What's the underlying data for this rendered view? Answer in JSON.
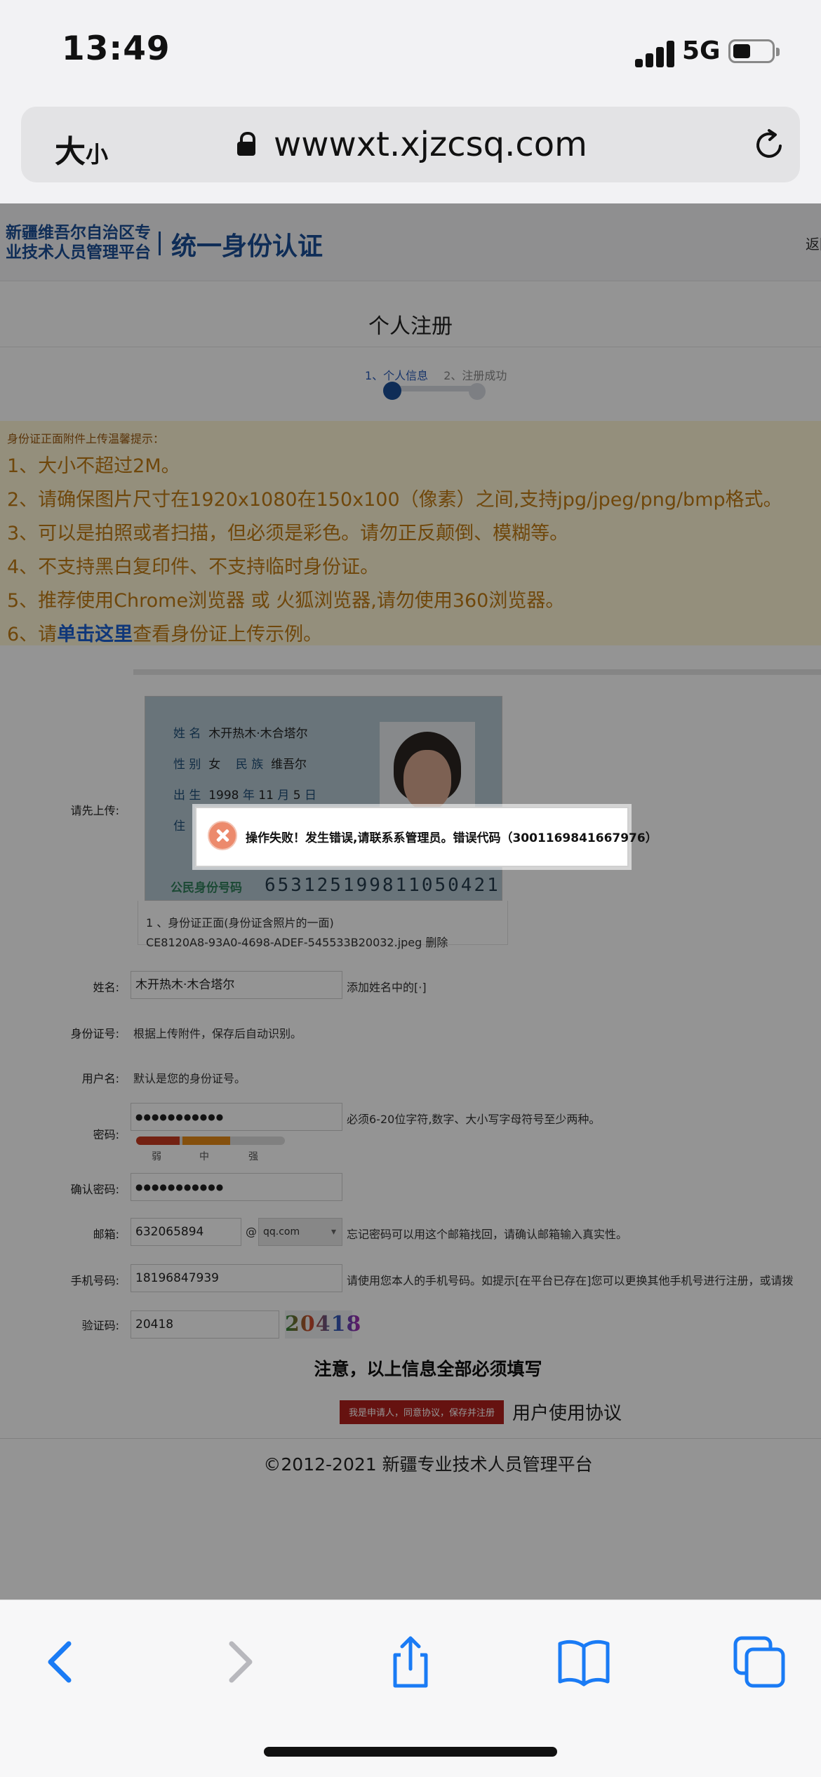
{
  "status_bar": {
    "time": "13:49",
    "network": "5G"
  },
  "browser": {
    "text_size_label": "大",
    "text_size_small": "小",
    "url": "wwwxt.xjzcsq.com"
  },
  "site": {
    "logo_line1": "新疆维吾尔自治区专",
    "logo_line2": "业技术人员管理平台",
    "logo_right": "统一身份认证",
    "back_link": "返回"
  },
  "page_title": "个人注册",
  "steps": {
    "step1": "1、个人信息",
    "step2": "2、注册成功"
  },
  "tips": {
    "title": "身份证正面附件上传温馨提示：",
    "items": [
      "1、大小不超过2M。",
      "2、请确保图片尺寸在1920x1080在150x100（像素）之间,支持jpg/jpeg/png/bmp格式。",
      "3、可以是拍照或者扫描，但必须是彩色。请勿正反颠倒、模糊等。",
      "4、不支持黑白复印件、不支持临时身份证。",
      "5、推荐使用Chrome浏览器 或 火狐浏览器,请勿使用360浏览器。"
    ],
    "item6_prefix": "6、请",
    "item6_link": "单击这里",
    "item6_suffix": "查看身份证上传示例。"
  },
  "form": {
    "upload_label": "请先上传:",
    "id_card": {
      "name_label": "姓 名",
      "name_value": "木开热木·木合塔尔",
      "sex_label": "性 别",
      "sex_value": "女",
      "ethnic_label": "民 族",
      "ethnic_value": "维吾尔",
      "birth_label": "出 生",
      "birth_year": "1998",
      "birth_year_unit": "年",
      "birth_month": "11",
      "birth_month_unit": "月",
      "birth_day": "5",
      "birth_day_unit": "日",
      "address_label": "住",
      "id_label": "公民身份号码",
      "id_number": "653125199811050421"
    },
    "file_caption": "1 、身份证正面(身份证含照片的一面)",
    "file_name": "CE8120A8-93A0-4698-ADEF-545533B20032.jpeg",
    "file_delete": "删除",
    "name_label": "姓名:",
    "name_value": "木开热木·木合塔尔",
    "name_hint": "添加姓名中的[·]",
    "idnum_label": "身份证号:",
    "idnum_hint": "根据上传附件，保存后自动识别。",
    "username_label": "用户名:",
    "username_hint": "默认是您的身份证号。",
    "password_label": "密码:",
    "password_value": "●●●●●●●●●●●",
    "password_hint": "必须6-20位字符,数字、大小写字母符号至少两种。",
    "strength_weak": "弱",
    "strength_mid": "中",
    "strength_strong": "强",
    "confirm_label": "确认密码:",
    "confirm_value": "●●●●●●●●●●●",
    "email_label": "邮箱:",
    "email_value": "632065894",
    "email_at": "@",
    "email_domain": "qq.com",
    "email_hint": "忘记密码可以用这个邮箱找回，请确认邮箱输入真实性。",
    "phone_label": "手机号码:",
    "phone_value": "18196847939",
    "phone_hint": "请使用您本人的手机号码。如提示[在平台已存在]您可以更换其他手机号进行注册，或请拨",
    "captcha_label": "验证码:",
    "captcha_value": "20418",
    "captcha_image_text": "20418",
    "notice": "注意，以上信息全部必须填写",
    "submit": "我是申请人，同意协议，保存并注册",
    "agreement": "用户使用协议"
  },
  "footer": "©2012-2021 新疆专业技术人员管理平台",
  "dialog": {
    "message": "操作失败！发生错误,请联系系管理员。错误代码（3001169841667976）"
  },
  "colors": {
    "brand_blue": "#1b4f97",
    "tip_orange": "#c07a14",
    "submit_red": "#b0201c",
    "ios_blue": "#1a7bf5"
  }
}
